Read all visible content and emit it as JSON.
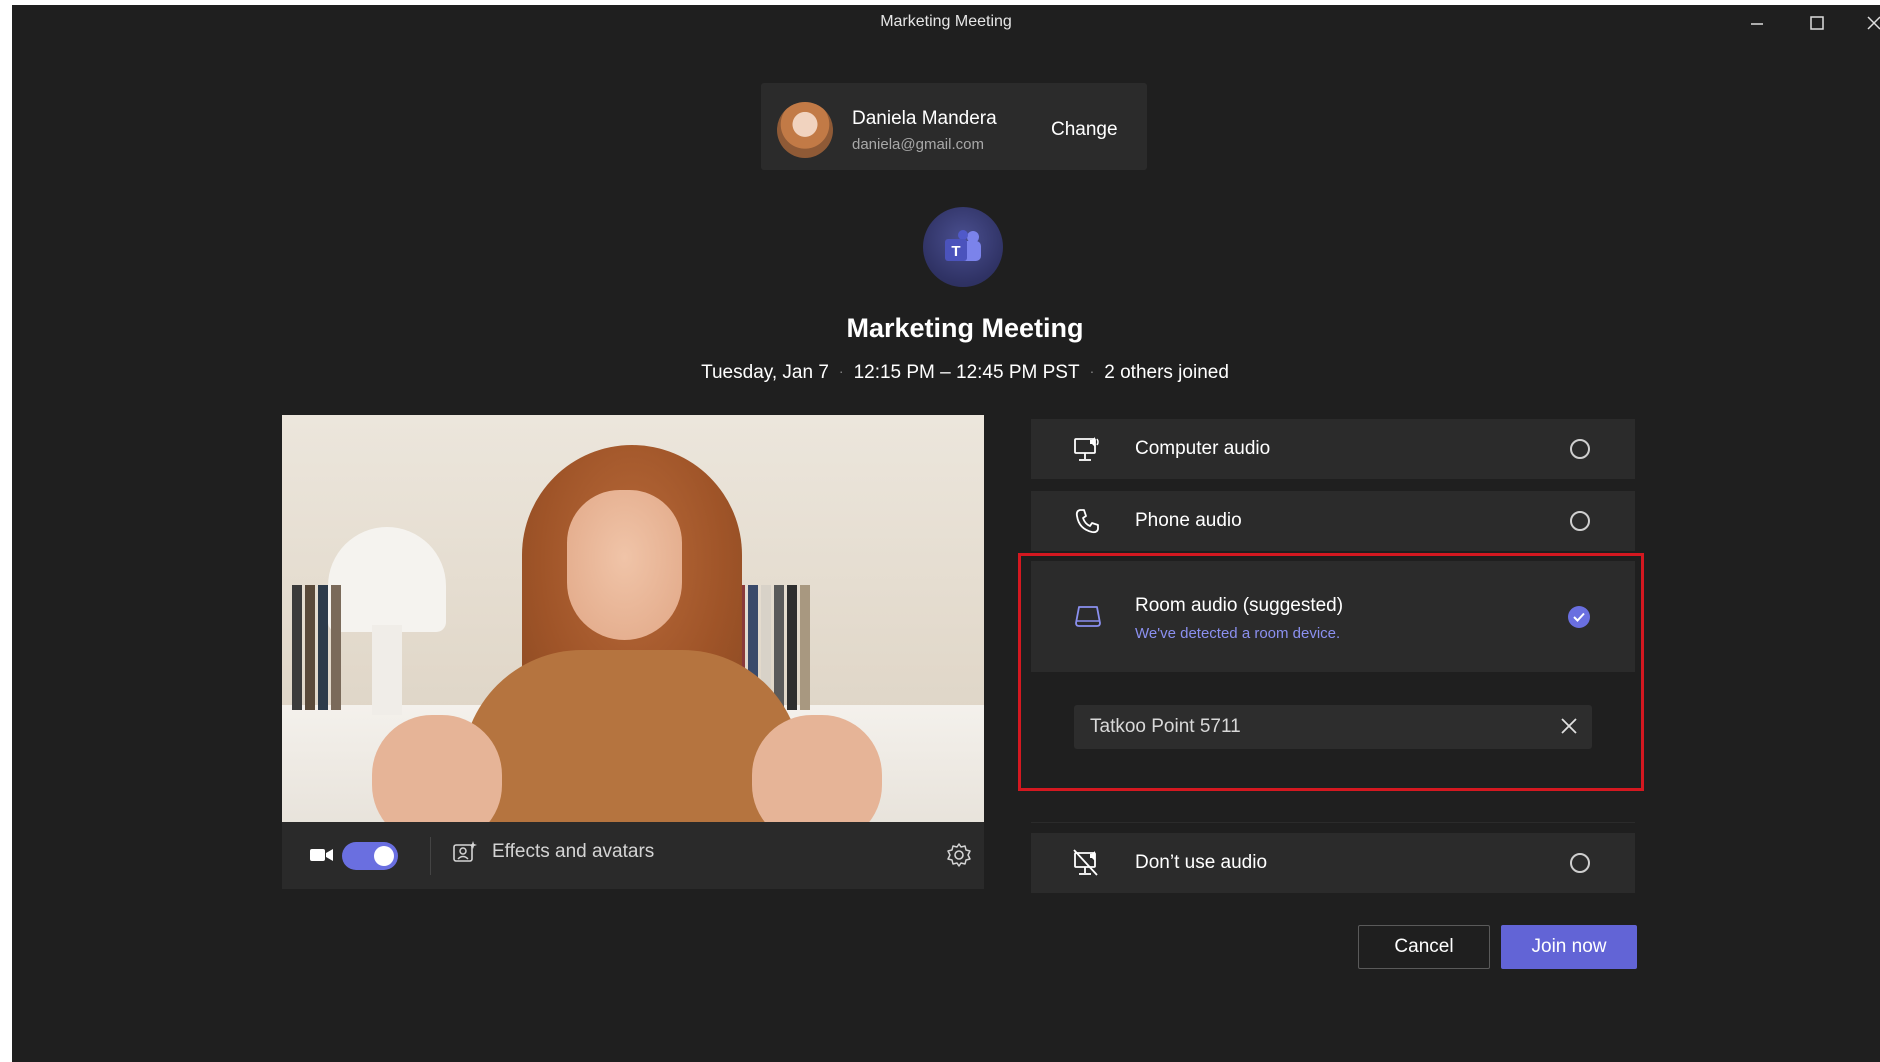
{
  "window": {
    "title": "Marketing Meeting",
    "controls": [
      "minimize-icon",
      "maximize-icon",
      "close-icon"
    ]
  },
  "account": {
    "name": "Daniela Mandera",
    "email": "daniela@gmail.com",
    "change_label": "Change"
  },
  "meeting": {
    "title": "Marketing Meeting",
    "date": "Tuesday, Jan 7",
    "time": "12:15 PM – 12:45 PM PST",
    "attendees": "2 others joined",
    "separator": "·"
  },
  "video_bar": {
    "camera_on": true,
    "effects_label": "Effects and avatars"
  },
  "audio_options": {
    "computer": {
      "label": "Computer audio",
      "selected": false
    },
    "phone": {
      "label": "Phone audio",
      "selected": false
    },
    "room": {
      "label": "Room audio",
      "suffix": "(suggested)",
      "subtext": "We've detected a room device.",
      "selected": true,
      "device": "Tatkoo Point 5711"
    },
    "none": {
      "label": "Don’t use audio",
      "selected": false
    }
  },
  "actions": {
    "cancel_label": "Cancel",
    "join_label": "Join now"
  },
  "colors": {
    "accent": "#6264d6",
    "highlight": "#d41820",
    "background": "#1f1f1f",
    "panel": "#2b2b2b"
  }
}
